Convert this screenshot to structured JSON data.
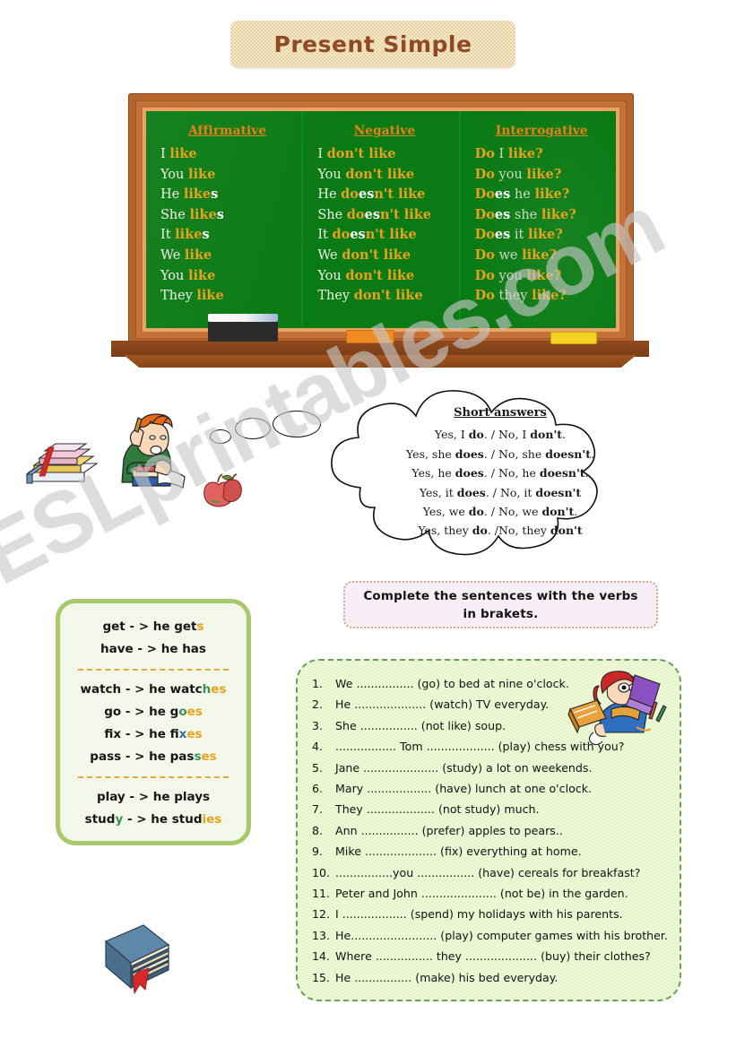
{
  "title": {
    "text": "Present Simple"
  },
  "blackboard": {
    "columns": [
      {
        "heading": "Affirmative",
        "rows": [
          {
            "pronoun": "I",
            "verb": "like",
            "suffix": ""
          },
          {
            "pronoun": "You",
            "verb": "like",
            "suffix": ""
          },
          {
            "pronoun": "He",
            "verb": "like",
            "suffix": "s"
          },
          {
            "pronoun": "She",
            "verb": "like",
            "suffix": "s"
          },
          {
            "pronoun": "It",
            "verb": "like",
            "suffix": "s"
          },
          {
            "pronoun": "We",
            "verb": "like",
            "suffix": ""
          },
          {
            "pronoun": "You",
            "verb": "like",
            "suffix": ""
          },
          {
            "pronoun": "They",
            "verb": "like",
            "suffix": ""
          }
        ]
      },
      {
        "heading": "Negative",
        "rows": [
          {
            "pronoun": "I",
            "aux_a": "don",
            "aux_hl": "",
            "aux_b": "'t like"
          },
          {
            "pronoun": "You",
            "aux_a": "don",
            "aux_hl": "",
            "aux_b": "'t like"
          },
          {
            "pronoun": "He",
            "aux_a": "do",
            "aux_hl": "es",
            "aux_b": "n't like"
          },
          {
            "pronoun": "She",
            "aux_a": "do",
            "aux_hl": "es",
            "aux_b": "n't like"
          },
          {
            "pronoun": "It",
            "aux_a": "do",
            "aux_hl": "es",
            "aux_b": "n't like"
          },
          {
            "pronoun": "We",
            "aux_a": "don",
            "aux_hl": "",
            "aux_b": "'t like"
          },
          {
            "pronoun": "You",
            "aux_a": "don",
            "aux_hl": "",
            "aux_b": "'t like"
          },
          {
            "pronoun": "They",
            "aux_a": "don",
            "aux_hl": "",
            "aux_b": "'t like"
          }
        ]
      },
      {
        "heading": "Interrogative",
        "rows": [
          {
            "aux_a": "Do",
            "aux_hl": "",
            "pronoun": "I",
            "verb": "like",
            "mark": "?"
          },
          {
            "aux_a": "Do",
            "aux_hl": "",
            "pronoun": "you",
            "verb": "like",
            "mark": "?"
          },
          {
            "aux_a": "Do",
            "aux_hl": "es",
            "pronoun": "he",
            "verb": "like",
            "mark": "?"
          },
          {
            "aux_a": "Do",
            "aux_hl": "es",
            "pronoun": "she",
            "verb": "like",
            "mark": "?"
          },
          {
            "aux_a": "Do",
            "aux_hl": "es",
            "pronoun": "it",
            "verb": "like",
            "mark": "?"
          },
          {
            "aux_a": "Do",
            "aux_hl": "",
            "pronoun": "we",
            "verb": "like",
            "mark": "?"
          },
          {
            "aux_a": "Do",
            "aux_hl": "",
            "pronoun": "you",
            "verb": "like",
            "mark": "?"
          },
          {
            "aux_a": "Do",
            "aux_hl": "",
            "pronoun": "they",
            "verb": "like",
            "mark": "?"
          }
        ]
      }
    ],
    "ledge_items": [
      "eraser",
      "orange-chalk",
      "yellow-chalk"
    ]
  },
  "short_answers": {
    "title": "Short answers",
    "lines": [
      {
        "yes_pre": "Yes, I ",
        "yes_b": "do",
        "mid": ". / No, I ",
        "no_b": "don't",
        "end": "."
      },
      {
        "yes_pre": "Yes, she ",
        "yes_b": "does",
        "mid": ". / No, she ",
        "no_b": "doesn't",
        "end": "."
      },
      {
        "yes_pre": "Yes, he ",
        "yes_b": "does",
        "mid": ". / No, he ",
        "no_b": "doesn't",
        "end": "."
      },
      {
        "yes_pre": "Yes, it ",
        "yes_b": "does",
        "mid": ". / No, it ",
        "no_b": "doesn't",
        "end": ""
      },
      {
        "yes_pre": "Yes, we ",
        "yes_b": "do",
        "mid": ". / No, we ",
        "no_b": "don't",
        "end": "."
      },
      {
        "yes_pre": "Yes, they ",
        "yes_b": "do",
        "mid": ". /No, they ",
        "no_b": "don't",
        "end": ""
      }
    ]
  },
  "instruction": {
    "text": "Complete the sentences with the verbs in brakets."
  },
  "spelling_rules": {
    "groups": [
      [
        {
          "base": "get",
          "arrow": "-  >",
          "result_pre": "he get",
          "result_hl": "s",
          "hl_color": "orange",
          "result_post": ""
        },
        {
          "base": "have",
          "arrow": "-  >",
          "result_pre": "he has",
          "result_hl": "",
          "hl_color": "",
          "result_post": ""
        }
      ],
      [
        {
          "base": "watch",
          "arrow": "-  >",
          "result_pre": "he watc",
          "result_hl": "h",
          "hl_color": "green",
          "result_post": "es",
          "post_color": "orange"
        },
        {
          "base": "go",
          "arrow": "-  >",
          "result_pre": "he g",
          "result_hl": "o",
          "hl_color": "green",
          "result_post": "es",
          "post_color": "orange"
        },
        {
          "base": "fix",
          "arrow": "-  >",
          "result_pre": "he fi",
          "result_hl": "x",
          "hl_color": "blue",
          "result_post": "es",
          "post_color": "orange"
        },
        {
          "base": "pass",
          "arrow": "-  >",
          "result_pre": "he pas",
          "result_hl": "s",
          "hl_color": "green",
          "result_post": "es",
          "post_color": "orange"
        }
      ],
      [
        {
          "base": "play",
          "arrow": "-  >",
          "result_pre": "he plays",
          "result_hl": "",
          "hl_color": "",
          "result_post": ""
        },
        {
          "base_pre": "stud",
          "base_hl": "y",
          "base_hl_color": "green",
          "base": "study",
          "arrow": "-  >",
          "result_pre": "he stud",
          "result_hl": "ies",
          "hl_color": "orange",
          "result_post": ""
        }
      ]
    ]
  },
  "exercise": {
    "items": [
      {
        "num": "1.",
        "text": "We ................ (go) to bed at nine o'clock."
      },
      {
        "num": "2.",
        "text": "He .................... (watch) TV everyday."
      },
      {
        "num": "3.",
        "text": "She ................ (not like) soup."
      },
      {
        "num": "4.",
        "text": "................. Tom ................... (play) chess with you?"
      },
      {
        "num": "5.",
        "text": "Jane ..................... (study) a lot on weekends."
      },
      {
        "num": "6.",
        "text": "Mary .................. (have) lunch at one o'clock."
      },
      {
        "num": "7.",
        "text": "They ................... (not study) much."
      },
      {
        "num": "8.",
        "text": "Ann ................ (prefer) apples to pears.."
      },
      {
        "num": "9.",
        "text": "Mike .................... (fix) everything at home."
      },
      {
        "num": "10.",
        "text": " ................you ................ (have)  cereals for breakfast?"
      },
      {
        "num": "11.",
        "text": "Peter and John ..................... (not be)  in the garden."
      },
      {
        "num": "12.",
        "text": "I  .................. (spend) my holidays with his parents."
      },
      {
        "num": "13.",
        "text": "He........................ (play) computer games with his brother."
      },
      {
        "num": "14.",
        "text": "Where ................ they .................... (buy) their  clothes?"
      },
      {
        "num": "15.",
        "text": "He ................ (make) his bed everyday."
      }
    ]
  },
  "watermark": {
    "text": "ESLprintables.com"
  },
  "colors": {
    "board_green": "#0a7a14",
    "chalk_orange": "#e8a21c",
    "title_brown": "#8d4a24",
    "title_bg": "#e9d3a2",
    "spell_border": "#a8c86a",
    "exercise_bg": "#e4f4c4",
    "exercise_border": "#6e9e55",
    "instruction_bg": "#f7eef5"
  }
}
